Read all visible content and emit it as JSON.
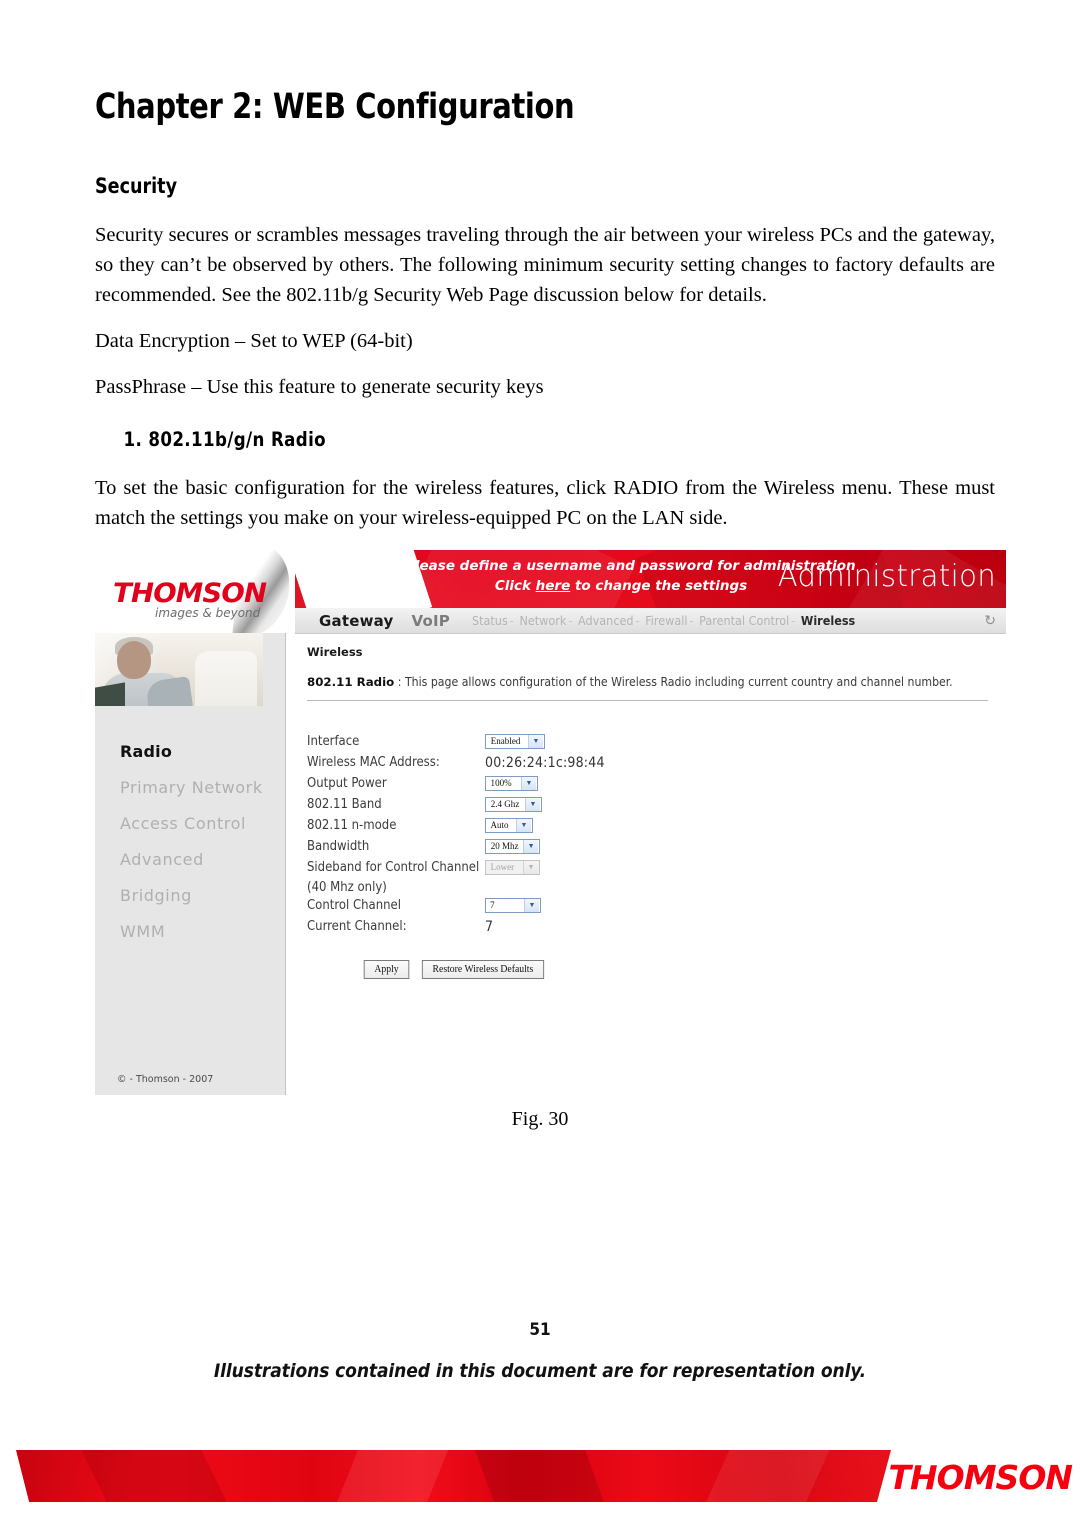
{
  "document": {
    "chapter_title": "Chapter 2: WEB Configuration",
    "section_heading": "Security",
    "intro_paragraph": "Security secures or scrambles messages traveling through the air between your wireless PCs and the gateway, so they can’t be observed by others. The following minimum security setting changes to factory defaults are recommended. See the 802.11b/g Security Web Page discussion below for details.",
    "line_data_encryption": "Data Encryption – Set to WEP (64-bit)",
    "line_passphrase": "PassPhrase – Use this feature to generate security keys",
    "numbered_heading": "1.  802.11b/g/n Radio",
    "paragraph_after_heading": "To set the basic configuration for the wireless features, click RADIO from the Wireless menu. These must match the settings you make on your wireless-equipped PC on the LAN side.",
    "figure_caption": "Fig. 30",
    "page_number": "51",
    "footer_note": "Illustrations contained in this document are for representation only.",
    "bottom_brand": "THOMSON"
  },
  "screenshot": {
    "brand": {
      "wordmark": "THOMSON",
      "tagline": "images & beyond"
    },
    "banner": {
      "message_line1": "Please define a username and password for administration",
      "message_line2_pre": "Click ",
      "message_line2_link": "here",
      "message_line2_post": " to change the settings",
      "title": "Administration",
      "color": "#e2001a"
    },
    "nav": {
      "primary": "Gateway",
      "secondary": "VoIP",
      "items": [
        "Status",
        "Network",
        "Advanced",
        "Firewall",
        "Parental Control",
        "Wireless"
      ],
      "active": "Wireless",
      "refresh_icon": "refresh-icon"
    },
    "sidebar": {
      "items": [
        "Radio",
        "Primary Network",
        "Access Control",
        "Advanced",
        "Bridging",
        "WMM"
      ],
      "active": "Radio",
      "copyright": "© - Thomson - 2007"
    },
    "content": {
      "breadcrumb": "Wireless",
      "page_title": "802.11 Radio",
      "page_title_sep": ":",
      "page_description": "This page allows configuration of the Wireless Radio including current country and channel number.",
      "fields": [
        {
          "label": "Interface",
          "type": "select",
          "value": "Enabled",
          "disabled": false
        },
        {
          "label": "Wireless MAC Address:",
          "type": "text",
          "value": "00:26:24:1c:98:44"
        },
        {
          "label": "Output Power",
          "type": "select",
          "value": "100%",
          "disabled": false
        },
        {
          "label": "802.11 Band",
          "type": "select",
          "value": "2.4 Ghz",
          "disabled": false
        },
        {
          "label": "802.11 n-mode",
          "type": "select",
          "value": "Auto",
          "disabled": false
        },
        {
          "label": "Bandwidth",
          "type": "select",
          "value": "20 Mhz",
          "disabled": false
        },
        {
          "label": "Sideband for Control Channel (40 Mhz only)",
          "type": "select",
          "value": "Lower",
          "disabled": true
        },
        {
          "label": "Control Channel",
          "type": "select",
          "value": "7",
          "disabled": false
        },
        {
          "label": "Current Channel:",
          "type": "text",
          "value": "7"
        }
      ],
      "buttons": {
        "apply": "Apply",
        "restore": "Restore Wireless Defaults"
      }
    }
  }
}
